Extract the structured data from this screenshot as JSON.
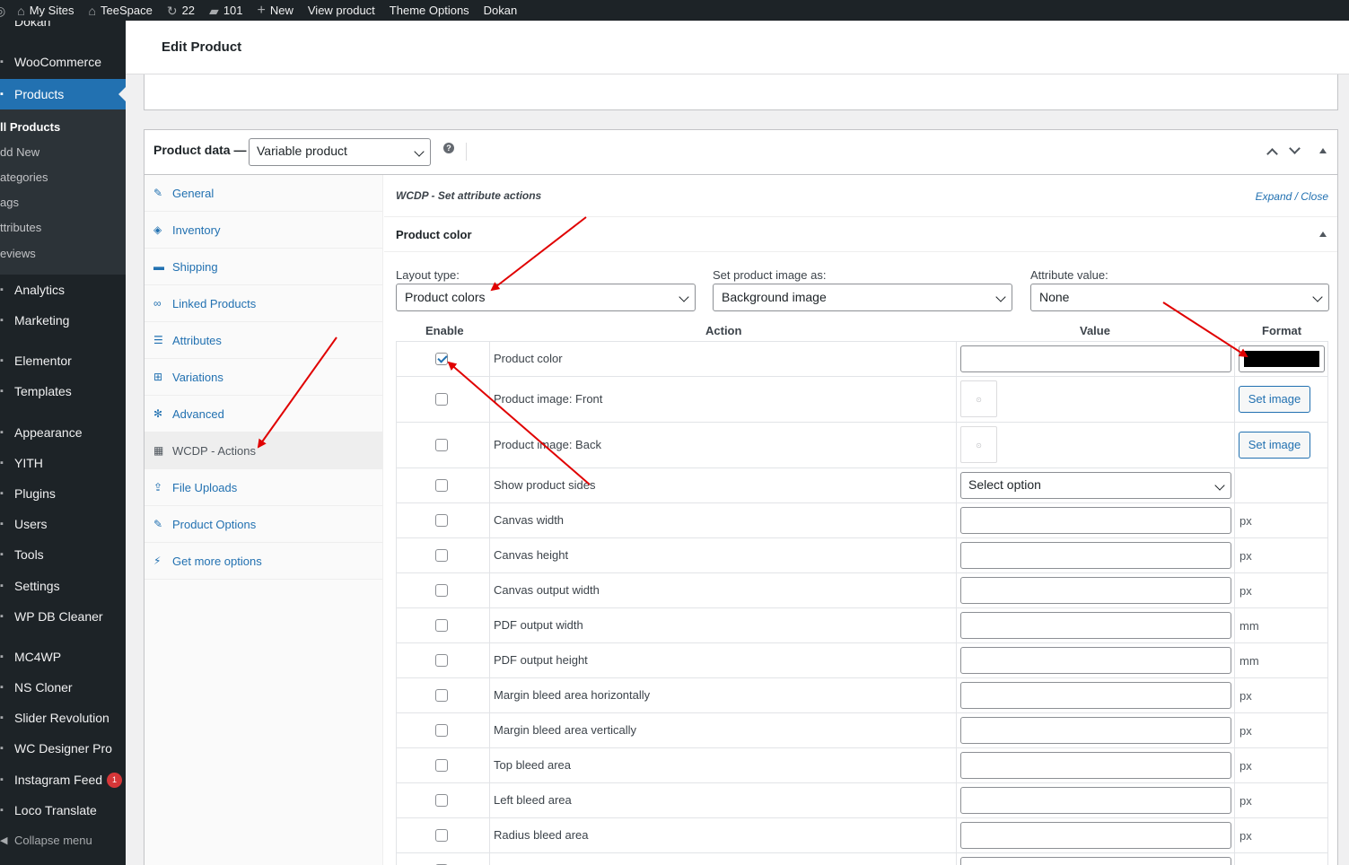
{
  "admin_bar": {
    "items": [
      {
        "icon": "my-sites-icon",
        "label": "My Sites"
      },
      {
        "icon": "home-icon",
        "label": "TeeSpace"
      },
      {
        "icon": "updates-icon",
        "label": "22"
      },
      {
        "icon": "comments-icon",
        "label": "101"
      },
      {
        "icon": "plus-icon",
        "label": "New"
      },
      {
        "icon": "",
        "label": "View product"
      },
      {
        "icon": "",
        "label": "Theme Options"
      },
      {
        "icon": "",
        "label": "Dokan"
      }
    ]
  },
  "sidebar": {
    "top_cut": "Dokan",
    "items": [
      {
        "label": "WooCommerce"
      },
      {
        "label": "Products"
      },
      {
        "label": "Analytics"
      },
      {
        "label": "Marketing"
      },
      {
        "label": "Elementor"
      },
      {
        "label": "Templates"
      },
      {
        "label": "Appearance"
      },
      {
        "label": "YITH"
      },
      {
        "label": "Plugins"
      },
      {
        "label": "Users"
      },
      {
        "label": "Tools"
      },
      {
        "label": "Settings"
      },
      {
        "label": "WP DB Cleaner"
      },
      {
        "label": "MC4WP"
      },
      {
        "label": "NS Cloner"
      },
      {
        "label": "Slider Revolution"
      },
      {
        "label": "WC Designer Pro"
      },
      {
        "label": "Instagram Feed",
        "badge": "1"
      },
      {
        "label": "Loco Translate"
      }
    ],
    "submenu": [
      "ll Products",
      "dd New",
      "ategories",
      "ags",
      "ttributes",
      "eviews"
    ],
    "collapse_label": "Collapse menu"
  },
  "header": {
    "title": "Edit Product"
  },
  "product_data": {
    "label": "Product data —",
    "type_value": "Variable product",
    "help": "?",
    "tabs": [
      {
        "label": "General",
        "icon": "wrench-icon"
      },
      {
        "label": "Inventory",
        "icon": "tag-icon"
      },
      {
        "label": "Shipping",
        "icon": "truck-icon"
      },
      {
        "label": "Linked Products",
        "icon": "link-icon"
      },
      {
        "label": "Attributes",
        "icon": "list-icon"
      },
      {
        "label": "Variations",
        "icon": "grid-icon"
      },
      {
        "label": "Advanced",
        "icon": "gear-icon"
      },
      {
        "label": "WCDP - Actions",
        "icon": "blocks-icon"
      },
      {
        "label": "File Uploads",
        "icon": "upload-icon"
      },
      {
        "label": "Product Options",
        "icon": "wrench-icon"
      },
      {
        "label": "Get more options",
        "icon": "plugin-icon"
      }
    ]
  },
  "panel": {
    "section_title": "WCDP - Set attribute actions",
    "expand_close": "Expand / Close",
    "attribute_title": "Product color",
    "layout_type": {
      "label": "Layout type:",
      "value": "Product colors"
    },
    "image_as": {
      "label": "Set product image as:",
      "value": "Background image"
    },
    "attribute_value": {
      "label": "Attribute value:",
      "value": "None"
    },
    "columns": {
      "enable": "Enable",
      "action": "Action",
      "value": "Value",
      "format": "Format"
    },
    "rows": [
      {
        "action": "Product color",
        "checked": true,
        "kind": "color",
        "format_color": "#000000"
      },
      {
        "action": "Product image: Front",
        "checked": false,
        "kind": "image",
        "button": "Set image"
      },
      {
        "action": "Product image: Back",
        "checked": false,
        "kind": "image",
        "button": "Set image"
      },
      {
        "action": "Show product sides",
        "checked": false,
        "kind": "select",
        "select_value": "Select option"
      },
      {
        "action": "Canvas width",
        "checked": false,
        "kind": "text",
        "unit": "px"
      },
      {
        "action": "Canvas height",
        "checked": false,
        "kind": "text",
        "unit": "px"
      },
      {
        "action": "Canvas output width",
        "checked": false,
        "kind": "text",
        "unit": "px"
      },
      {
        "action": "PDF output width",
        "checked": false,
        "kind": "text",
        "unit": "mm"
      },
      {
        "action": "PDF output height",
        "checked": false,
        "kind": "text",
        "unit": "mm"
      },
      {
        "action": "Margin bleed area horizontally",
        "checked": false,
        "kind": "text",
        "unit": "px"
      },
      {
        "action": "Margin bleed area vertically",
        "checked": false,
        "kind": "text",
        "unit": "px"
      },
      {
        "action": "Top bleed area",
        "checked": false,
        "kind": "text",
        "unit": "px"
      },
      {
        "action": "Left bleed area",
        "checked": false,
        "kind": "text",
        "unit": "px"
      },
      {
        "action": "Radius bleed area",
        "checked": false,
        "kind": "text",
        "unit": "px"
      }
    ]
  },
  "colors": {
    "accent": "#2271b1",
    "annotation": "#e00000",
    "sidebar_bg": "#1d2327"
  }
}
